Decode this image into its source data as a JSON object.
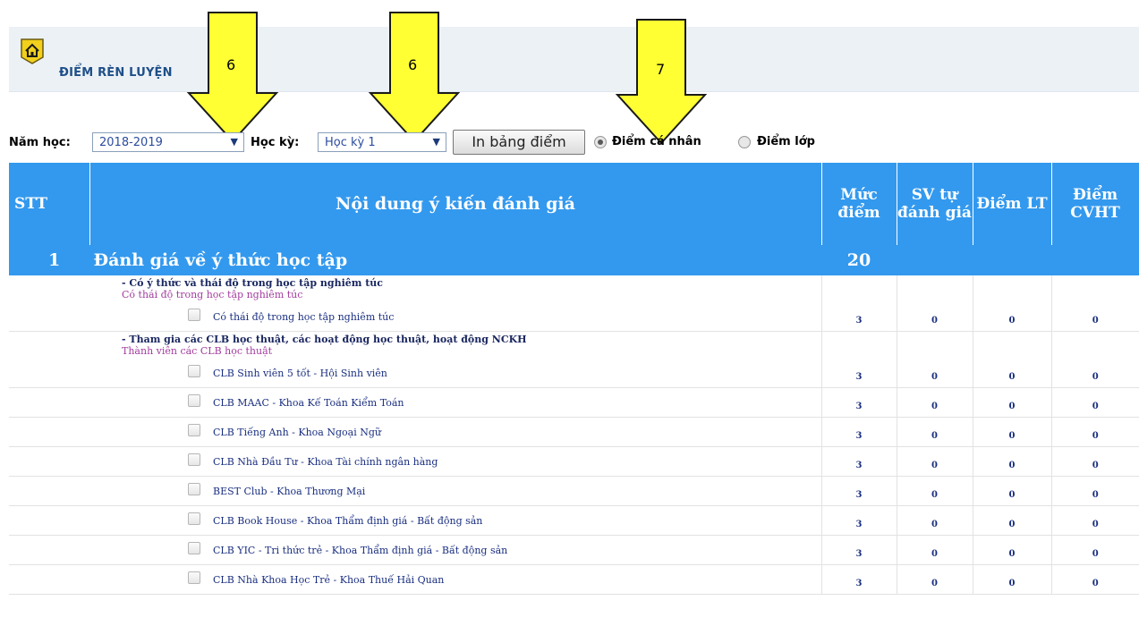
{
  "banner": {
    "title": "ĐIỂM RÈN LUYỆN"
  },
  "callouts": [
    "6",
    "6",
    "7"
  ],
  "filters": {
    "year_label": "Năm học:",
    "year_value": "2018-2019",
    "term_label": "Học kỳ:",
    "term_value": "Học kỳ 1",
    "print_label": "In bảng điểm",
    "radio_personal": "Điểm cá nhân",
    "radio_class": "Điểm lớp"
  },
  "table": {
    "headers": {
      "stt": "STT",
      "content": "Nội dung ý kiến đánh giá",
      "max": "Mức điểm",
      "self": "SV tự đánh giá",
      "lt": "Điểm LT",
      "cvht": "Điểm CVHT"
    },
    "group": {
      "number": "1",
      "title": "Đánh giá về ý thức học tập",
      "score": "20"
    },
    "sections": [
      {
        "title": "- Có ý thức và thái độ trong học tập nghiêm túc",
        "subtitle": "Có thái độ trong học tập nghiêm túc",
        "items": [
          {
            "label": "Có thái độ trong học tập nghiêm túc",
            "max": "3",
            "self": "0",
            "lt": "0",
            "cvht": "0"
          }
        ]
      },
      {
        "title": "- Tham gia các CLB học thuật, các hoạt động học thuật, hoạt động NCKH",
        "subtitle": "Thành viên các CLB học thuật",
        "items": [
          {
            "label": "CLB Sinh viên 5 tốt - Hội Sinh viên",
            "max": "3",
            "self": "0",
            "lt": "0",
            "cvht": "0"
          },
          {
            "label": "CLB MAAC - Khoa Kế Toán Kiểm Toán",
            "max": "3",
            "self": "0",
            "lt": "0",
            "cvht": "0"
          },
          {
            "label": "CLB Tiếng Anh - Khoa Ngoại Ngữ",
            "max": "3",
            "self": "0",
            "lt": "0",
            "cvht": "0"
          },
          {
            "label": "CLB Nhà Đầu Tư - Khoa Tài chính ngân hàng",
            "max": "3",
            "self": "0",
            "lt": "0",
            "cvht": "0"
          },
          {
            "label": "BEST Club - Khoa Thương Mại",
            "max": "3",
            "self": "0",
            "lt": "0",
            "cvht": "0"
          },
          {
            "label": "CLB Book House - Khoa Thẩm định giá - Bất động sản",
            "max": "3",
            "self": "0",
            "lt": "0",
            "cvht": "0"
          },
          {
            "label": "CLB YIC - Tri thức trẻ - Khoa Thẩm định giá - Bất động sản",
            "max": "3",
            "self": "0",
            "lt": "0",
            "cvht": "0"
          },
          {
            "label": "CLB Nhà Khoa Học Trẻ - Khoa Thuế Hải Quan",
            "max": "3",
            "self": "0",
            "lt": "0",
            "cvht": "0"
          }
        ]
      }
    ]
  },
  "colors": {
    "header_bg": "#3399ee",
    "banner_bg": "#ecf1f6",
    "callout_fill": "#ffff33"
  }
}
